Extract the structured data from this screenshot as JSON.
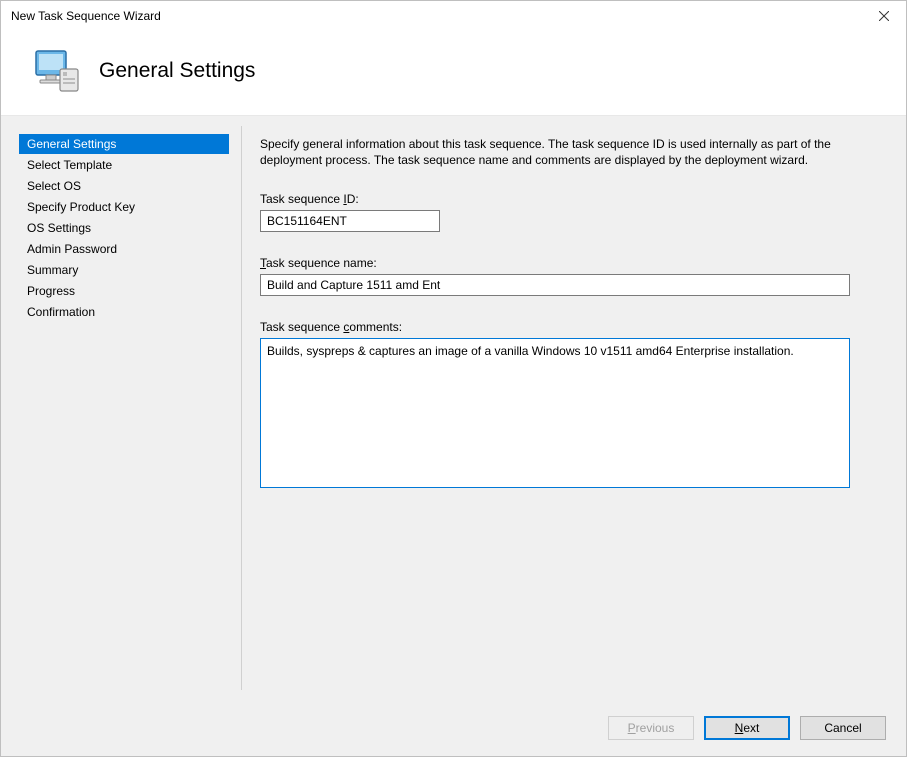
{
  "window": {
    "title": "New Task Sequence Wizard"
  },
  "header": {
    "title": "General Settings"
  },
  "sidebar": {
    "items": [
      {
        "label": "General Settings",
        "selected": true
      },
      {
        "label": "Select Template",
        "selected": false
      },
      {
        "label": "Select OS",
        "selected": false
      },
      {
        "label": "Specify Product Key",
        "selected": false
      },
      {
        "label": "OS Settings",
        "selected": false
      },
      {
        "label": "Admin Password",
        "selected": false
      },
      {
        "label": "Summary",
        "selected": false
      },
      {
        "label": "Progress",
        "selected": false
      },
      {
        "label": "Confirmation",
        "selected": false
      }
    ]
  },
  "content": {
    "description": "Specify general information about this task sequence.  The task sequence ID is used internally as part of the deployment process.  The task sequence name and comments are displayed by the deployment wizard.",
    "id_label_pre": "Task sequence ",
    "id_label_hot": "I",
    "id_label_post": "D:",
    "id_value": "BC151164ENT",
    "name_label_hot": "T",
    "name_label_post": "ask sequence name:",
    "name_value": "Build and Capture 1511 amd Ent",
    "comments_label_pre": "Task sequence ",
    "comments_label_hot": "c",
    "comments_label_post": "omments:",
    "comments_value": "Builds, syspreps & captures an image of a vanilla Windows 10 v1511 amd64 Enterprise installation."
  },
  "footer": {
    "previous_hot": "P",
    "previous_post": "revious",
    "next_hot": "N",
    "next_post": "ext",
    "cancel": "Cancel"
  }
}
